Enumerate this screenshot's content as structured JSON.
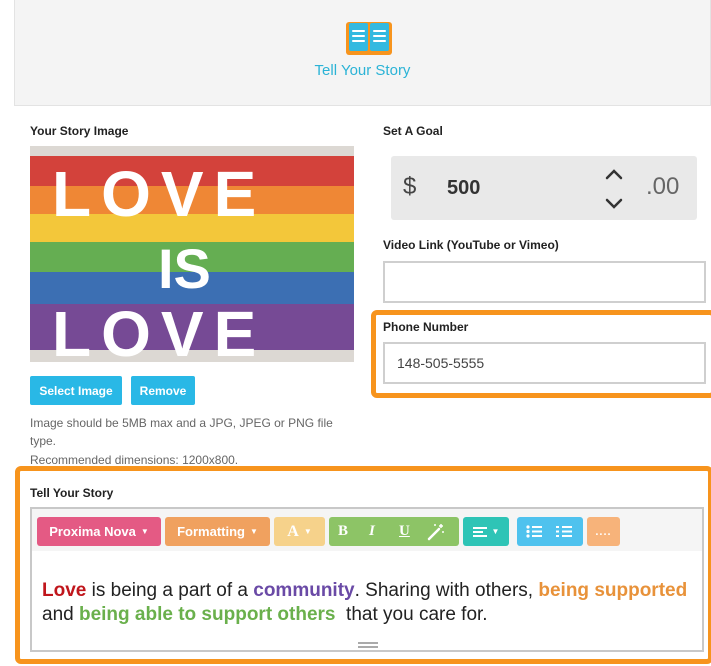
{
  "header": {
    "title": "Tell Your Story",
    "icon": "open-book-icon",
    "accent": "#2bb3d6"
  },
  "image_section": {
    "label": "Your Story Image",
    "image_alt": "LOVE IS LOVE",
    "select_button": "Select Image",
    "remove_button": "Remove",
    "hint_lines": [
      "Image should be 5MB max and a JPG, JPEG or PNG file",
      "type.",
      "Recommended dimensions: 1200x800."
    ]
  },
  "goal": {
    "label": "Set A Goal",
    "currency": "$",
    "amount": "500",
    "cents": ".00"
  },
  "video": {
    "label": "Video Link (YouTube or Vimeo)",
    "value": ""
  },
  "phone": {
    "label": "Phone Number",
    "value": "148-505-5555"
  },
  "story": {
    "label": "Tell Your Story",
    "toolbar": {
      "font": "Proxima Nova",
      "formatting": "Formatting",
      "color_button": "A",
      "bold": "B",
      "italic": "I",
      "underline": "U"
    },
    "text": {
      "w1": "Love",
      "t1": " is being a part of a ",
      "w2": "community",
      "t2": ". Sharing with others, ",
      "w3": "being supported",
      "t3": " and ",
      "w4": "being able to support others",
      "t4": "  that you care for."
    }
  },
  "colors": {
    "highlight": "#f7941d",
    "button": "#29b8e6"
  }
}
